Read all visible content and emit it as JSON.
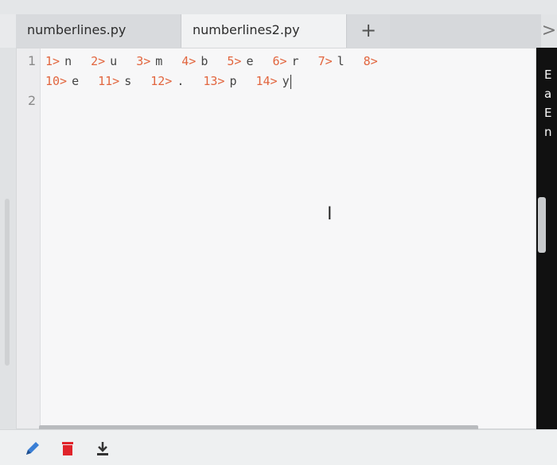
{
  "tabs": [
    {
      "label": "numberlines.py",
      "active": false
    },
    {
      "label": "numberlines2.py",
      "active": true
    }
  ],
  "add_tab_label": "+",
  "overflow_label": ">",
  "gutter": [
    "1",
    "2"
  ],
  "code": {
    "line1": [
      {
        "prefix": "1>",
        "char": "n"
      },
      {
        "prefix": "2>",
        "char": "u"
      },
      {
        "prefix": "3>",
        "char": "m"
      },
      {
        "prefix": "4>",
        "char": "b"
      },
      {
        "prefix": "5>",
        "char": "e"
      },
      {
        "prefix": "6>",
        "char": "r"
      },
      {
        "prefix": "7>",
        "char": "l"
      },
      {
        "prefix": "8>",
        "char": ""
      }
    ],
    "line1_wrap": [
      {
        "prefix": "10>",
        "char": "e"
      },
      {
        "prefix": "11>",
        "char": "s"
      },
      {
        "prefix": "12>",
        "char": "."
      },
      {
        "prefix": "13>",
        "char": "p"
      },
      {
        "prefix": "14>",
        "char": "y"
      }
    ]
  },
  "side_panel_text": [
    "E",
    "a",
    "E",
    "n"
  ],
  "icons": {
    "edit": "pencil-icon",
    "delete": "trash-icon",
    "download": "download-icon"
  },
  "colors": {
    "prefix": "#e2663f",
    "char": "#454545",
    "delete": "#e0242b",
    "edit": "#3a7fd5"
  }
}
